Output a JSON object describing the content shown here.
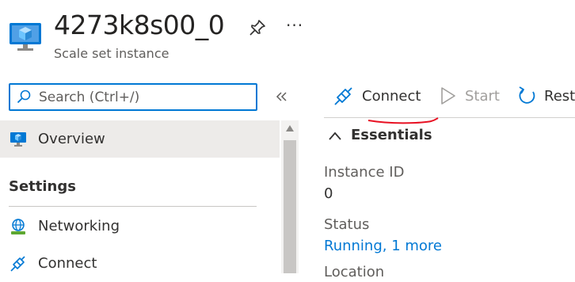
{
  "header": {
    "title": "4273k8s00_0",
    "subtitle": "Scale set instance",
    "pin_icon": "pin-icon",
    "more_label": "···"
  },
  "search": {
    "placeholder": "Search (Ctrl+/)",
    "value": ""
  },
  "sidebar": {
    "items": [
      {
        "label": "Overview",
        "icon": "vm-monitor-icon",
        "selected": true
      },
      {
        "label": "Networking",
        "icon": "network-globe-icon"
      },
      {
        "label": "Connect",
        "icon": "plug-icon"
      }
    ],
    "section_settings": "Settings"
  },
  "toolbar": {
    "connect_label": "Connect",
    "start_label": "Start",
    "restart_label": "Resta"
  },
  "essentials": {
    "heading": "Essentials",
    "instance_id_label": "Instance ID",
    "instance_id_value": "0",
    "status_label": "Status",
    "status_value": "Running, 1 more",
    "location_label": "Location"
  },
  "colors": {
    "accent": "#0078d4",
    "selected_bg": "#edebe9",
    "annotation": "#e81123",
    "disabled": "#a19f9d"
  }
}
